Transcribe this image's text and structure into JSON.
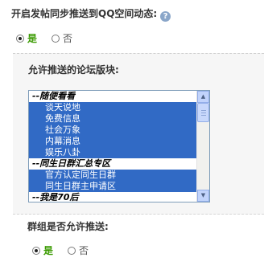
{
  "feed_push": {
    "title": "开启发帖同步推送到QQ空间动态:",
    "help_glyph": "?",
    "options": [
      {
        "label": "是",
        "checked": true
      },
      {
        "label": "否",
        "checked": false
      }
    ]
  },
  "boards": {
    "title": "允许推送的论坛版块:",
    "items": [
      {
        "text": "--随便看看",
        "group": true,
        "selected": false
      },
      {
        "text": "谈天说地",
        "group": false,
        "selected": true
      },
      {
        "text": "免费信息",
        "group": false,
        "selected": true
      },
      {
        "text": "社会万象",
        "group": false,
        "selected": true
      },
      {
        "text": "内幕消息",
        "group": false,
        "selected": true
      },
      {
        "text": "娱乐八卦",
        "group": false,
        "selected": true
      },
      {
        "text": "--同生日群汇总专区",
        "group": true,
        "selected": false
      },
      {
        "text": "官方认定同生日群",
        "group": false,
        "selected": true
      },
      {
        "text": "同生日群主申请区",
        "group": false,
        "selected": true
      },
      {
        "text": "--我是70后",
        "group": true,
        "selected": false
      }
    ]
  },
  "group_push": {
    "title": "群组是否允许推送:",
    "options": [
      {
        "label": "是",
        "checked": true
      },
      {
        "label": "否",
        "checked": false
      }
    ]
  },
  "colors": {
    "selection": "#316ac5",
    "checked_label": "#3a9a00",
    "help_icon": "#8aa6c9"
  }
}
